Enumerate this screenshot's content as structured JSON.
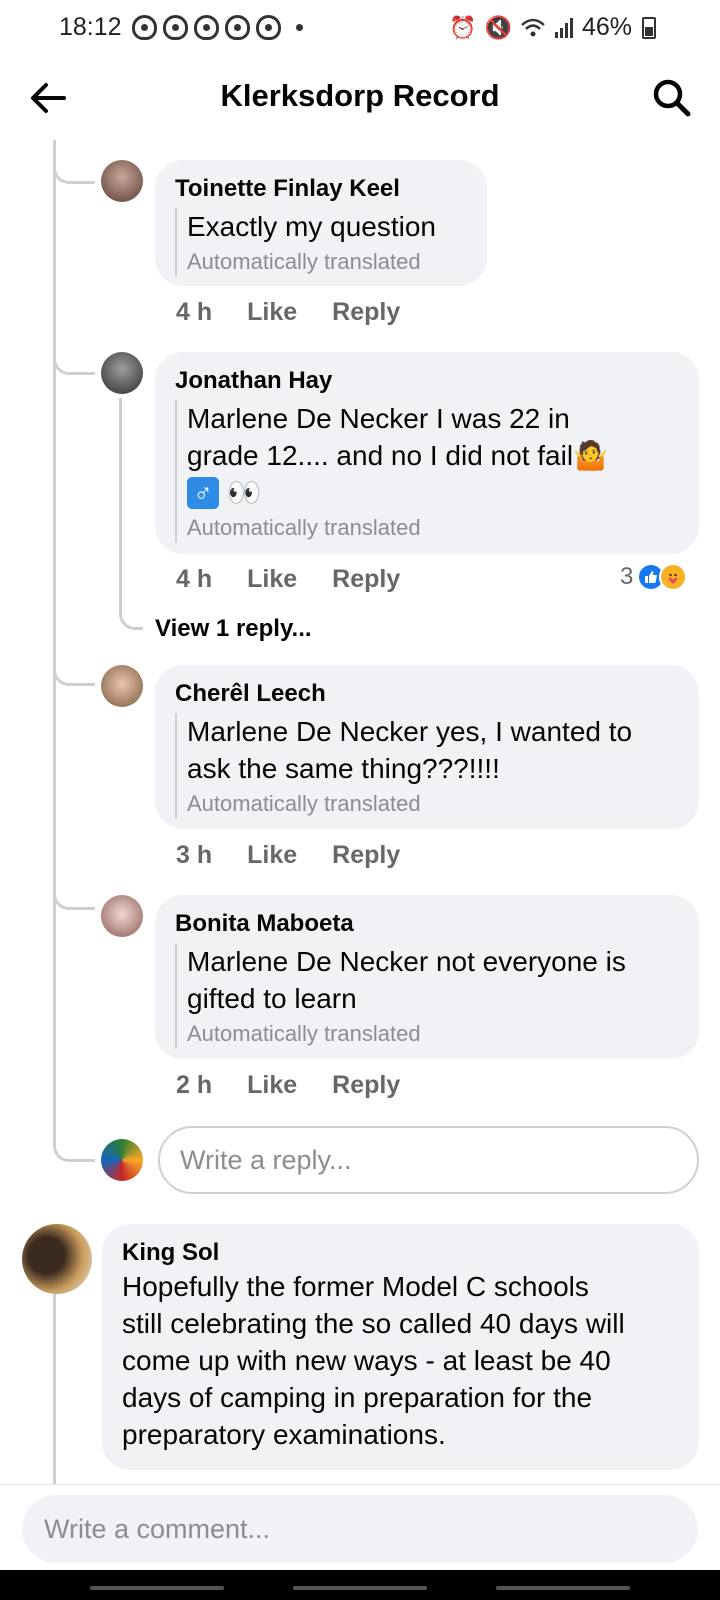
{
  "status_bar": {
    "time": "18:12",
    "battery": "46%"
  },
  "header": {
    "title": "Klerksdorp Record"
  },
  "comments": [
    {
      "author": "Toinette Finlay Keel",
      "text": "Exactly my question",
      "translated": "Automatically translated",
      "time": "4 h",
      "like": "Like",
      "reply": "Reply"
    },
    {
      "author": "Jonathan Hay",
      "text_line1": "Marlene De Necker I was 22 in",
      "text_line2": "grade 12.... and no I did not fail",
      "translated": "Automatically translated",
      "time": "4 h",
      "like": "Like",
      "reply": "Reply",
      "reaction_count": "3",
      "view_replies": "View 1 reply..."
    },
    {
      "author": "Cherêl Leech",
      "text_line1": "Marlene De Necker yes, I wanted to",
      "text_line2": "ask the same thing???!!!!",
      "translated": "Automatically translated",
      "time": "3 h",
      "like": "Like",
      "reply": "Reply"
    },
    {
      "author": "Bonita Maboeta",
      "text_line1": "Marlene De Necker not everyone is",
      "text_line2": "gifted to learn",
      "translated": "Automatically translated",
      "time": "2 h",
      "like": "Like",
      "reply": "Reply"
    }
  ],
  "reply_input": {
    "placeholder": "Write a reply..."
  },
  "top_comment": {
    "author": "King Sol",
    "lines": [
      "Hopefully the former Model C schools",
      "still celebrating the so called 40 days will",
      "come up with new ways - at least be 40",
      "days of camping in preparation for the",
      "preparatory examinations."
    ]
  },
  "comment_input": {
    "placeholder": "Write a comment..."
  },
  "colors": {
    "accent": "#1877f2",
    "bubble": "#f0f2f5",
    "meta": "#65676b"
  }
}
